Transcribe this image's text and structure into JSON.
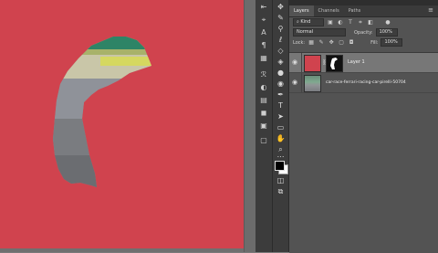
{
  "layers_panel": {
    "tabs": [
      {
        "label": "Layers",
        "active": true
      },
      {
        "label": "Channels",
        "active": false
      },
      {
        "label": "Paths",
        "active": false
      }
    ],
    "filter": {
      "value": "Kind"
    },
    "blend_mode": {
      "value": "Normal"
    },
    "opacity": {
      "label": "Opacity:",
      "value": "100%"
    },
    "lock": {
      "label": "Lock:"
    },
    "fill": {
      "label": "Fill:",
      "value": "100%"
    },
    "layers": [
      {
        "name": "Layer 1",
        "selected": true,
        "visible": true,
        "color": "#d0434e",
        "has_mask": true
      },
      {
        "name": "car-race-ferrari-racing-car-pirelli-50704",
        "selected": false,
        "visible": true
      }
    ]
  },
  "document": {
    "fill_color": "#d0434e"
  },
  "tools": [
    "move-tool",
    "marquee-tool",
    "lasso-tool",
    "quick-select-tool",
    "crop-tool",
    "eyedropper-tool",
    "healing-brush-tool",
    "brush-tool",
    "clone-stamp-tool",
    "history-brush-tool",
    "eraser-tool",
    "gradient-tool",
    "blur-tool",
    "dodge-tool",
    "pen-tool",
    "type-tool",
    "path-select-tool",
    "rectangle-tool",
    "hand-tool",
    "zoom-tool",
    "more-tools",
    "edit-toolbar",
    "swap-colors",
    "default-colors",
    "foreground-color",
    "background-color",
    "quick-mask",
    "screen-mode"
  ],
  "panel_icons": [
    "properties-icon",
    "brush-settings-icon",
    "character-icon",
    "paragraph-icon",
    "glyphs-icon",
    "styles-icon",
    "adjustments-icon",
    "swatches-icon",
    "color-icon",
    "libraries-icon",
    "navigator-icon"
  ]
}
